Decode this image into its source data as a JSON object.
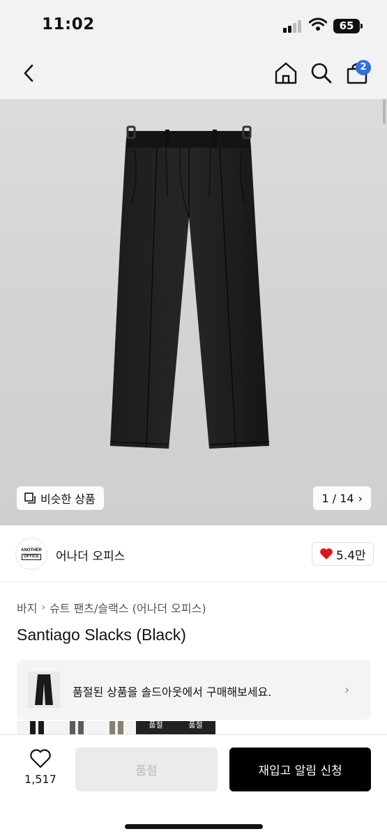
{
  "status_bar": {
    "time": "11:02",
    "battery": "65"
  },
  "nav": {
    "cart_count": "2"
  },
  "hero": {
    "similar_label": "비슷한 상품",
    "counter": "1 / 14",
    "counter_chevron": "›"
  },
  "brand": {
    "logo_line1": "ANOTHER",
    "logo_line2": "OFFICE",
    "name": "어나더 오피스",
    "likes": "5.4만"
  },
  "breadcrumb": {
    "items": [
      "바지",
      "슈트 팬츠/슬랙스 (어나더 오피스)"
    ],
    "separator": "›"
  },
  "product": {
    "title": "Santiago Slacks (Black)"
  },
  "soldout_banner": {
    "text": "품절된 상품을 솔드아웃에서 구매해보세요.",
    "chevron": "›"
  },
  "thumbnails": {
    "labels": [
      "품절",
      "품절"
    ]
  },
  "bottom_bar": {
    "wish_count": "1,517",
    "soldout_label": "품절",
    "restock_label": "재입고 알림 신청"
  },
  "colors": {
    "accent_badge": "#2f6fe4",
    "heart": "#e0141e",
    "primary_button": "#000000",
    "disabled_button": "#ebebeb"
  },
  "icons": [
    "back-icon",
    "home-icon",
    "search-icon",
    "shopping-bag-icon",
    "copy-icon",
    "heart-icon",
    "chevron-right-icon"
  ]
}
